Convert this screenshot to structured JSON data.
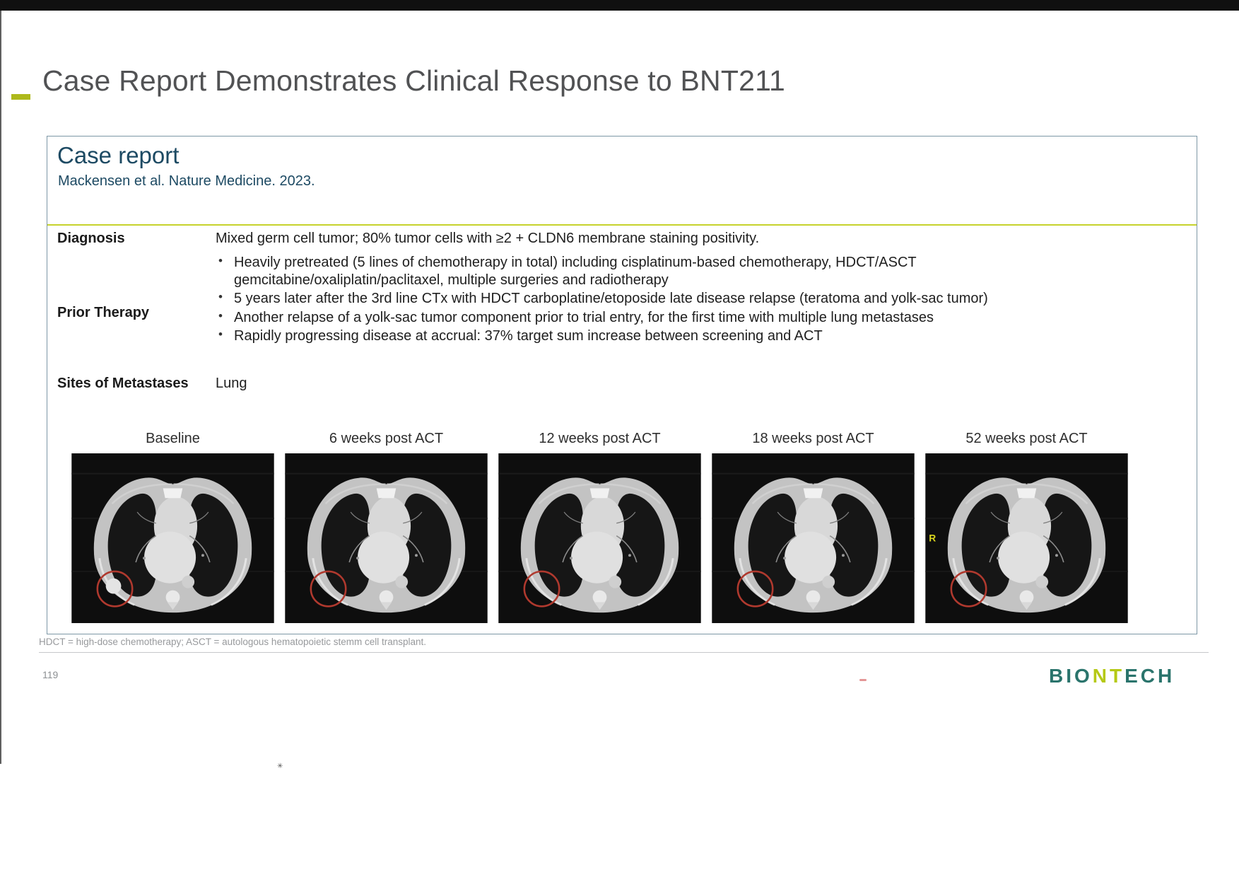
{
  "slide": {
    "title": "Case Report Demonstrates Clinical Response to BNT211"
  },
  "case_box": {
    "heading": "Case report",
    "source": "Mackensen et al. Nature Medicine. 2023.",
    "diagnosis_label": "Diagnosis",
    "diagnosis_text": "Mixed germ cell tumor; 80% tumor cells with ≥2 + CLDN6 membrane staining positivity.",
    "prior_therapy_label": "Prior Therapy",
    "prior_therapy_bullets": [
      "Heavily pretreated (5 lines of chemotherapy in total) including cisplatinum-based chemotherapy, HDCT/ASCT gemcitabine/oxaliplatin/paclitaxel, multiple surgeries and radiotherapy",
      "5 years later after the 3rd line CTx with HDCT carboplatine/etoposide late disease relapse (teratoma and yolk-sac tumor)",
      "Another relapse of a yolk-sac tumor component prior to trial entry, for the first time with multiple lung metastases",
      "Rapidly progressing disease at accrual: 37% target sum increase between screening and ACT"
    ],
    "metastases_label": "Sites of Metastases",
    "metastases_text": "Lung"
  },
  "scans": [
    {
      "label": "Baseline",
      "nodule": true,
      "r_marker": false
    },
    {
      "label": "6 weeks post ACT",
      "nodule": false,
      "r_marker": false
    },
    {
      "label": "12 weeks post ACT",
      "nodule": false,
      "r_marker": false
    },
    {
      "label": "18 weeks post ACT",
      "nodule": false,
      "r_marker": false
    },
    {
      "label": "52 weeks post ACT",
      "nodule": false,
      "r_marker": true
    }
  ],
  "footnote": "HDCT = high-dose chemotherapy; ASCT = autologous hematopoietic stemm cell transplant.",
  "page_number": "119",
  "logo": {
    "bio": "BIO",
    "nt": "NT",
    "ech": "ECH"
  },
  "colors": {
    "accent": "#c6d22c",
    "heading_blue": "#1d4a63",
    "logo_teal": "#2a746c",
    "logo_lime": "#b5c916",
    "annotation_red": "#b0392e"
  }
}
